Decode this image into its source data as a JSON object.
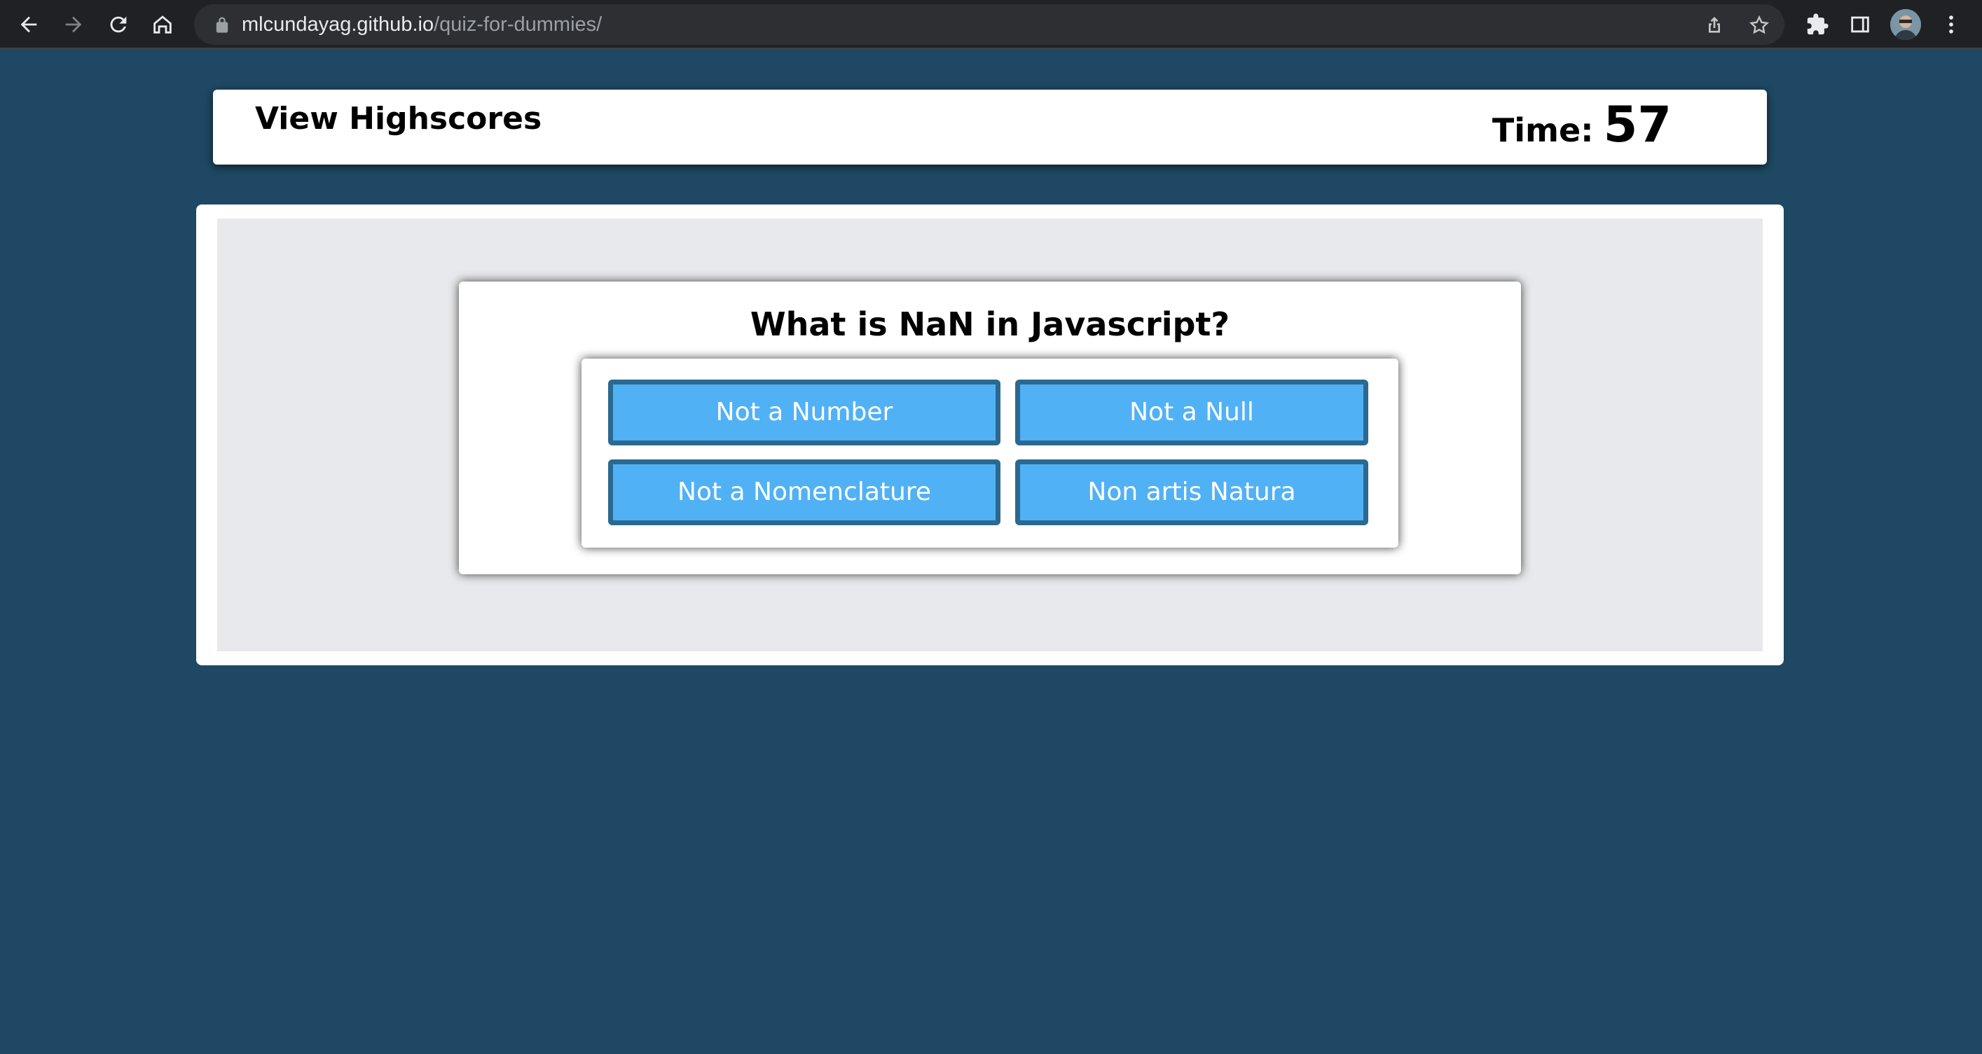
{
  "browser": {
    "url_host": "mlcundayag.github.io",
    "url_path": "/quiz-for-dummies/"
  },
  "header": {
    "highscores_link": "View Highscores",
    "timer_label": "Time:",
    "timer_value": "57"
  },
  "question": {
    "text": "What is NaN in Javascript?",
    "answers": [
      "Not a Number",
      "Not a Null",
      "Not a Nomenclature",
      "Non artis Natura"
    ]
  },
  "colors": {
    "page_background": "#1e4863",
    "answer_fill": "#51b1f5",
    "answer_border": "#2b6990"
  }
}
